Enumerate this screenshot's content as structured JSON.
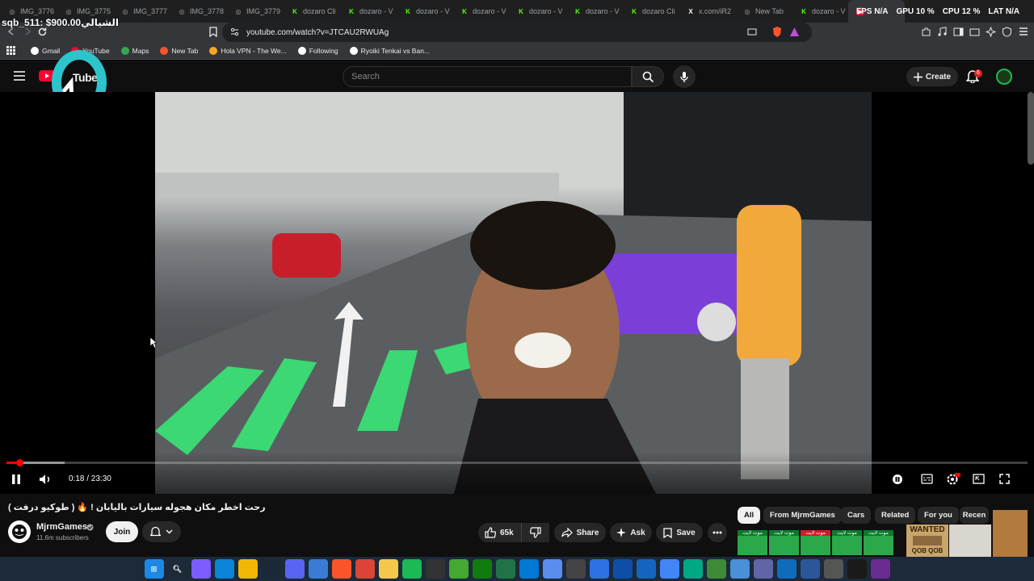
{
  "browser": {
    "tabs": [
      {
        "label": "IMG_3776",
        "icon": "globe-icon",
        "color": "#9aa0a6"
      },
      {
        "label": "IMG_3775",
        "icon": "globe-icon",
        "color": "#9aa0a6"
      },
      {
        "label": "IMG_3777",
        "icon": "globe-icon",
        "color": "#9aa0a6"
      },
      {
        "label": "IMG_3778",
        "icon": "globe-icon",
        "color": "#9aa0a6"
      },
      {
        "label": "IMG_3779",
        "icon": "globe-icon",
        "color": "#9aa0a6"
      },
      {
        "label": "dozaro Cli",
        "icon": "k-icon",
        "color": "#53fc18"
      },
      {
        "label": "dozaro - V",
        "icon": "k-icon",
        "color": "#53fc18"
      },
      {
        "label": "dozaro - V",
        "icon": "k-icon",
        "color": "#53fc18"
      },
      {
        "label": "dozaro - V",
        "icon": "k-icon",
        "color": "#53fc18"
      },
      {
        "label": "dozaro - V",
        "icon": "k-icon",
        "color": "#53fc18"
      },
      {
        "label": "dozaro - V",
        "icon": "k-icon",
        "color": "#53fc18"
      },
      {
        "label": "dozaro Cli",
        "icon": "k-icon",
        "color": "#53fc18"
      },
      {
        "label": "x.com/iR2",
        "icon": "x-icon",
        "color": "#ffffff"
      },
      {
        "label": "New Tab",
        "icon": "brave-icon",
        "color": "#9aa0a6"
      },
      {
        "label": "dozaro - V",
        "icon": "k-icon",
        "color": "#53fc18"
      },
      {
        "label": "",
        "icon": "youtube-icon",
        "color": "#ff0033",
        "active": true
      }
    ],
    "url": "youtube.com/watch?v=JTCAU2RWUAg",
    "bookmarks": [
      {
        "label": "Gmail",
        "icon": "google-icon",
        "color": "#ffffff"
      },
      {
        "label": "YouTube",
        "icon": "youtube-icon",
        "color": "#ff0033"
      },
      {
        "label": "Maps",
        "icon": "maps-icon",
        "color": "#34a853"
      },
      {
        "label": "New Tab",
        "icon": "brave-icon",
        "color": "#fb542b"
      },
      {
        "label": "Hola VPN - The We...",
        "icon": "hola-icon",
        "color": "#f5a623"
      },
      {
        "label": "Following",
        "icon": "x-icon",
        "color": "#ffffff"
      },
      {
        "label": "Ryoiki Tenkai vs Ban...",
        "icon": "tiktok-icon",
        "color": "#ffffff"
      }
    ]
  },
  "overlay": {
    "donation": "sqb_511: $900.00الشيالي",
    "fps": "FPS N/A",
    "gpu": "GPU 10 %",
    "cpu": "CPU 12 %",
    "lat": "LAT N/A"
  },
  "header": {
    "logo_text": "Tube",
    "search_placeholder": "Search",
    "create_label": "Create",
    "notification_count": "6"
  },
  "player": {
    "time": "0:18 / 23:30",
    "progress": 0.013,
    "buffered": 0.057
  },
  "video": {
    "title": "رحت اخطر مكان هجوله سيارات باليابان ! 🔥 ( طوكيو درفت )",
    "channel": "MjrmGames",
    "subscribers": "11.6m subscribers",
    "join_label": "Join",
    "likes": "65k",
    "share_label": "Share",
    "ask_label": "Ask",
    "save_label": "Save"
  },
  "chips": [
    "All",
    "From MjrmGames",
    "Cars",
    "Related",
    "For you",
    "Recen"
  ],
  "thumb_caption": "موت لايت",
  "wanted": {
    "line1": "WANTED",
    "line2": "QOB QOB"
  },
  "colors": {
    "accent": "#ff0000",
    "kick": "#53fc18",
    "bg": "#0f0f0f",
    "chip": "#272727"
  }
}
